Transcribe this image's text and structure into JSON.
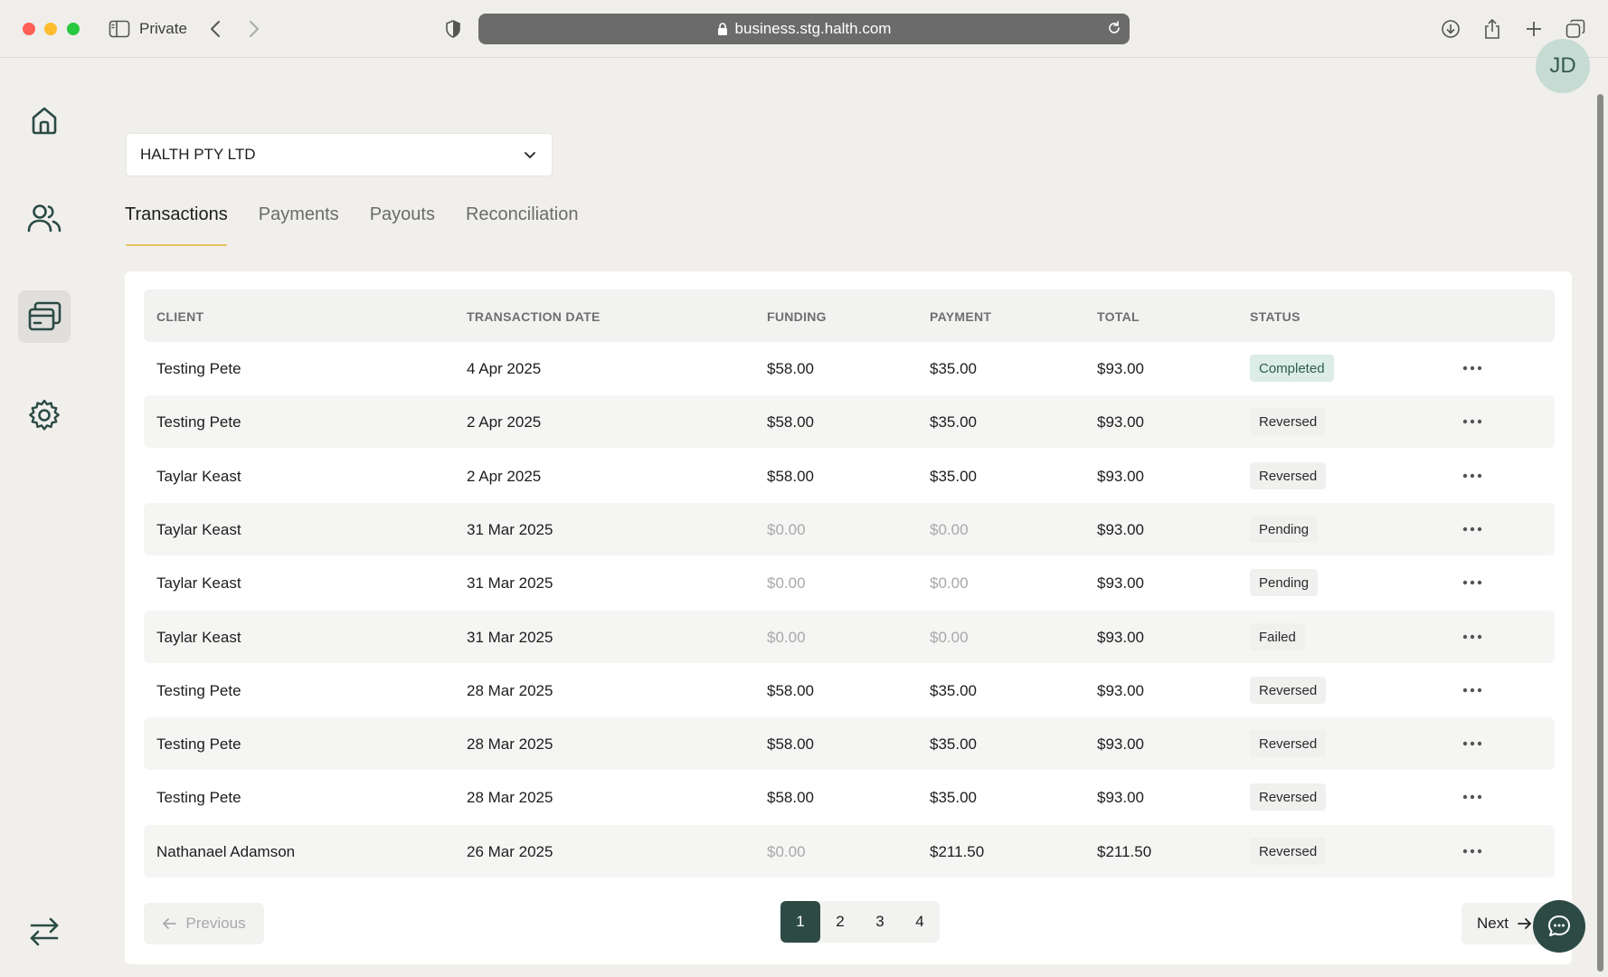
{
  "browser": {
    "private_label": "Private",
    "url": "business.stg.halth.com"
  },
  "user": {
    "initials": "JD"
  },
  "business_select": {
    "value": "HALTH PTY LTD"
  },
  "tabs": [
    {
      "label": "Transactions",
      "active": true
    },
    {
      "label": "Payments",
      "active": false
    },
    {
      "label": "Payouts",
      "active": false
    },
    {
      "label": "Reconciliation",
      "active": false
    }
  ],
  "table": {
    "columns": {
      "client": "CLIENT",
      "date": "TRANSACTION DATE",
      "funding": "FUNDING",
      "payment": "PAYMENT",
      "total": "TOTAL",
      "status": "STATUS"
    },
    "rows": [
      {
        "client": "Testing Pete",
        "date": "4 Apr 2025",
        "funding": "$58.00",
        "payment": "$35.00",
        "total": "$93.00",
        "status": "Completed"
      },
      {
        "client": "Testing Pete",
        "date": "2 Apr 2025",
        "funding": "$58.00",
        "payment": "$35.00",
        "total": "$93.00",
        "status": "Reversed"
      },
      {
        "client": "Taylar Keast",
        "date": "2 Apr 2025",
        "funding": "$58.00",
        "payment": "$35.00",
        "total": "$93.00",
        "status": "Reversed"
      },
      {
        "client": "Taylar Keast",
        "date": "31 Mar 2025",
        "funding": "$0.00",
        "payment": "$0.00",
        "total": "$93.00",
        "status": "Pending"
      },
      {
        "client": "Taylar Keast",
        "date": "31 Mar 2025",
        "funding": "$0.00",
        "payment": "$0.00",
        "total": "$93.00",
        "status": "Pending"
      },
      {
        "client": "Taylar Keast",
        "date": "31 Mar 2025",
        "funding": "$0.00",
        "payment": "$0.00",
        "total": "$93.00",
        "status": "Failed"
      },
      {
        "client": "Testing Pete",
        "date": "28 Mar 2025",
        "funding": "$58.00",
        "payment": "$35.00",
        "total": "$93.00",
        "status": "Reversed"
      },
      {
        "client": "Testing Pete",
        "date": "28 Mar 2025",
        "funding": "$58.00",
        "payment": "$35.00",
        "total": "$93.00",
        "status": "Reversed"
      },
      {
        "client": "Testing Pete",
        "date": "28 Mar 2025",
        "funding": "$58.00",
        "payment": "$35.00",
        "total": "$93.00",
        "status": "Reversed"
      },
      {
        "client": "Nathanael Adamson",
        "date": "26 Mar 2025",
        "funding": "$0.00",
        "payment": "$211.50",
        "total": "$211.50",
        "status": "Reversed"
      }
    ]
  },
  "pagination": {
    "previous_label": "Previous",
    "next_label": "Next",
    "pages": [
      "1",
      "2",
      "3",
      "4"
    ],
    "current_page": "1"
  },
  "colors": {
    "accent": "#2d4a45",
    "tab_underline": "#e5c25a",
    "completed_badge": "#dcece6"
  }
}
